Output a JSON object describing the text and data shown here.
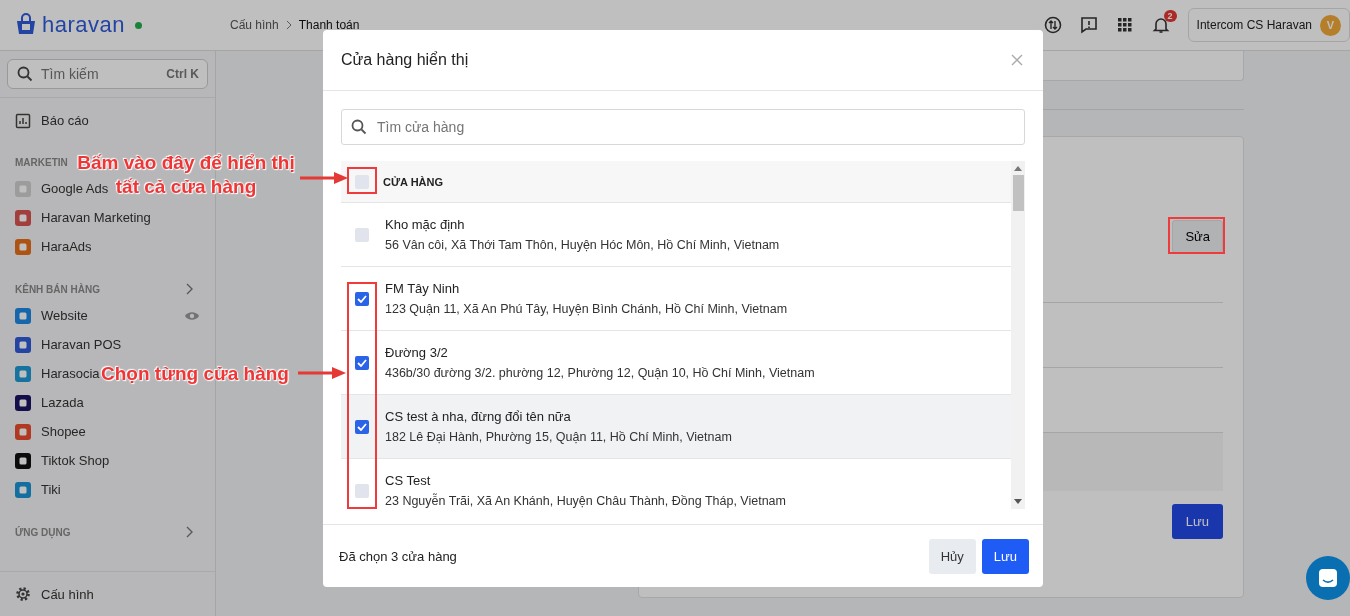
{
  "topbar": {
    "logo": "haravan",
    "online": true,
    "breadcrumb": [
      "Cấu hình",
      "Thanh toán"
    ],
    "notification_count": "2",
    "account": {
      "name": "Intercom CS Haravan",
      "avatar": "V"
    }
  },
  "sidebar": {
    "search": {
      "placeholder": "Tìm kiếm",
      "shortcut": "Ctrl K"
    },
    "top_items": [
      {
        "label": "Báo cáo"
      }
    ],
    "sections": [
      {
        "title": "MARKETIN",
        "items": [
          {
            "label": "Google Ads"
          },
          {
            "label": "Haravan Marketing"
          },
          {
            "label": "HaraAds"
          }
        ]
      },
      {
        "title": "KÊNH BÁN HÀNG",
        "expandable": true,
        "items": [
          {
            "label": "Website",
            "visible_toggle": true
          },
          {
            "label": "Haravan POS"
          },
          {
            "label": "Harasocia"
          },
          {
            "label": "Lazada"
          },
          {
            "label": "Shopee"
          },
          {
            "label": "Tiktok Shop"
          },
          {
            "label": "Tiki"
          }
        ]
      },
      {
        "title": "ỨNG DỤNG",
        "expandable": true
      }
    ],
    "footer": {
      "label": "Cấu hình"
    }
  },
  "main": {
    "edit_button": "Sửa",
    "save_button": "Lưu"
  },
  "modal": {
    "title": "Cửa hàng hiển thị",
    "search": {
      "placeholder": "Tìm cửa hàng"
    },
    "header": {
      "label": "CỬA HÀNG",
      "checked": false
    },
    "stores": [
      {
        "name": "Kho mặc định",
        "address": "56 Vân côi, Xã Thới Tam Thôn, Huyện Hóc Môn, Hồ Chí Minh, Vietnam",
        "checked": false,
        "hovered": false
      },
      {
        "name": "FM Tây Ninh",
        "address": "123 Quận 11, Xã An Phú Tây, Huyện Bình Chánh, Hồ Chí Minh, Vietnam",
        "checked": true,
        "hovered": false
      },
      {
        "name": "Đường 3/2",
        "address": "436b/30 đường 3/2. phường 12, Phường 12, Quận 10, Hồ Chí Minh, Vietnam",
        "checked": true,
        "hovered": false
      },
      {
        "name": "CS test à nha, đừng đổi tên nữa",
        "address": "182 Lê Đại Hành, Phường 15, Quận 11, Hồ Chí Minh, Vietnam",
        "checked": true,
        "hovered": true
      },
      {
        "name": "CS Test",
        "address": "23 Nguyễn Trãi, Xã An Khánh, Huyện Châu Thành, Đồng Tháp, Vietnam",
        "checked": false,
        "hovered": false
      }
    ],
    "summary": "Đã chọn 3 cửa hàng",
    "buttons": [
      {
        "label": "Hủy",
        "kind": "secondary"
      },
      {
        "label": "Lưu",
        "kind": "primary"
      }
    ]
  },
  "annotations": [
    {
      "lines": [
        "Bấm vào đây để hiển thị",
        "tất cả cửa hàng"
      ]
    },
    {
      "lines": [
        "Chọn từng cửa hàng"
      ]
    }
  ]
}
